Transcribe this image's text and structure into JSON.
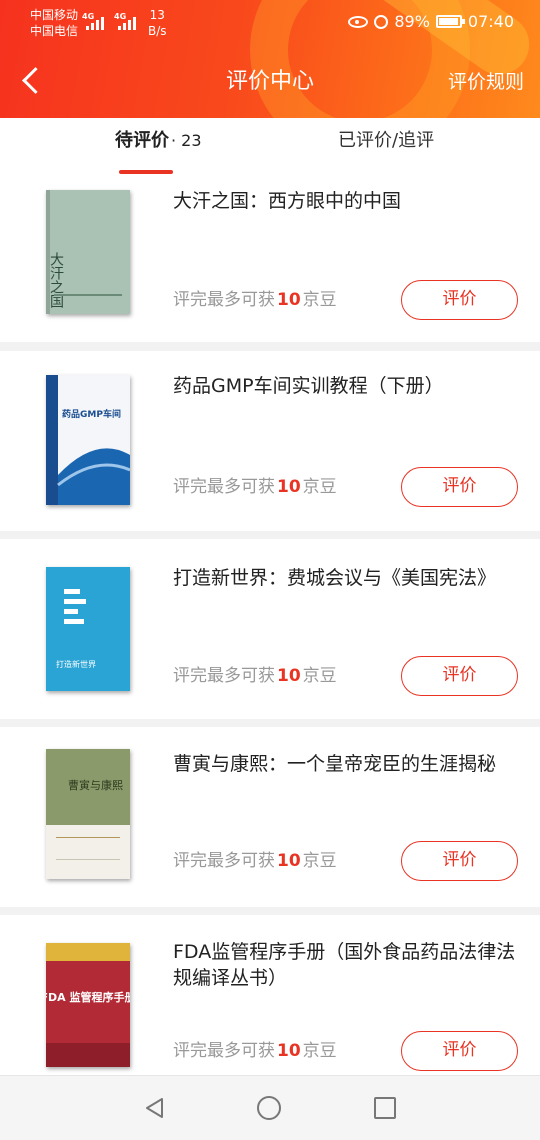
{
  "status_bar": {
    "carrier1": "中国移动",
    "carrier2": "中国电信",
    "signal1": "4G",
    "signal2": "4G",
    "net_speed_value": "13",
    "net_speed_unit": "B/s",
    "battery": "89%",
    "time": "07:40"
  },
  "header": {
    "title": "评价中心",
    "rules_label": "评价规则"
  },
  "tabs": {
    "pending_label": "待评价",
    "pending_count": "· 23",
    "done_label": "已评价/追评"
  },
  "items": [
    {
      "title": "大汗之国：西方眼中的中国",
      "reward_prefix": "评完最多可获",
      "reward_points": "10",
      "reward_unit": "京豆",
      "button": "评价",
      "cover_color": "#a9c2b3",
      "cover_text": "大汗之国"
    },
    {
      "title": "药品GMP车间实训教程（下册）",
      "reward_prefix": "评完最多可获",
      "reward_points": "10",
      "reward_unit": "京豆",
      "button": "评价",
      "cover_color": "#ffffff",
      "cover_text": "药品GMP车间"
    },
    {
      "title": "打造新世界：费城会议与《美国宪法》",
      "reward_prefix": "评完最多可获",
      "reward_points": "10",
      "reward_unit": "京豆",
      "button": "评价",
      "cover_color": "#2aa4d5",
      "cover_text": "打造新世界"
    },
    {
      "title": "曹寅与康熙：一个皇帝宠臣的生涯揭秘",
      "reward_prefix": "评完最多可获",
      "reward_points": "10",
      "reward_unit": "京豆",
      "button": "评价",
      "cover_color": "#8a9a6a",
      "cover_text": "曹寅与康熙"
    },
    {
      "title": "FDA监管程序手册（国外食品药品法律法规编译丛书）",
      "reward_prefix": "评完最多可获",
      "reward_points": "10",
      "reward_unit": "京豆",
      "button": "评价",
      "cover_color": "#b22a36",
      "cover_text": "FDA 监管程序手册"
    }
  ],
  "colors": {
    "accent": "#e93323",
    "header_start": "#f6321e",
    "header_end": "#ff8a1c"
  }
}
